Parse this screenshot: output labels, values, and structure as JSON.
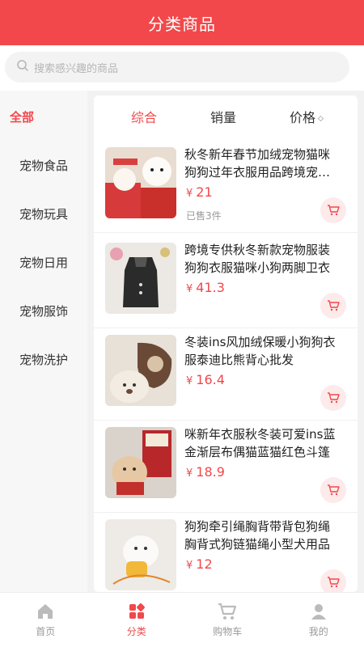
{
  "header": {
    "title": "分类商品"
  },
  "search": {
    "placeholder": "搜索感兴趣的商品"
  },
  "sidebar": {
    "items": [
      {
        "label": "全部"
      },
      {
        "label": "宠物食品"
      },
      {
        "label": "宠物玩具"
      },
      {
        "label": "宠物日用"
      },
      {
        "label": "宠物服饰"
      },
      {
        "label": "宠物洗护"
      }
    ]
  },
  "sort": {
    "composite": "综合",
    "sales": "销量",
    "price": "价格"
  },
  "currency": "¥",
  "products": [
    {
      "title": "秋冬新年春节加绒宠物猫咪狗狗过年衣服用品跨境宠物服装",
      "price": "21",
      "sold": "已售3件"
    },
    {
      "title": "跨境专供秋冬新款宠物服装狗狗衣服猫咪小狗两脚卫衣",
      "price": "41.3",
      "sold": ""
    },
    {
      "title": "冬装ins风加绒保暖小狗狗衣服泰迪比熊背心批发",
      "price": "16.4",
      "sold": ""
    },
    {
      "title": "咪新年衣服秋冬装可爱ins蓝金渐层布偶猫蓝猫红色斗篷",
      "price": "18.9",
      "sold": ""
    },
    {
      "title": "狗狗牵引绳胸背带背包狗绳胸背式狗链猫绳小型犬用品",
      "price": "12",
      "sold": ""
    }
  ],
  "tabbar": {
    "home": "首页",
    "category": "分类",
    "cart": "购物车",
    "mine": "我的"
  },
  "colors": {
    "accent": "#f2484b",
    "sidebar_bg": "#f7f7f7"
  }
}
